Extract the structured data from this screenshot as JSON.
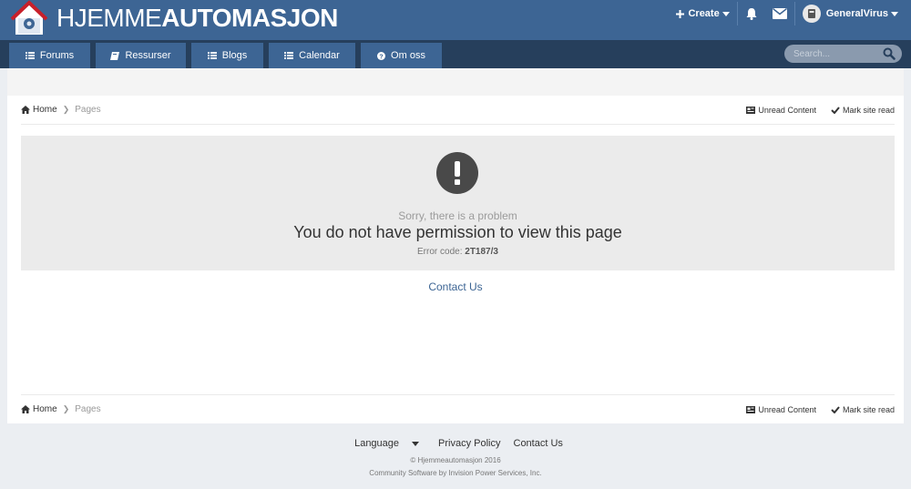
{
  "header": {
    "title_light": "HJEMME",
    "title_bold": "AUTOMASJON",
    "create_label": "Create",
    "username": "GeneralVirus"
  },
  "nav": {
    "tabs": [
      {
        "label": "Forums",
        "icon": "list-icon"
      },
      {
        "label": "Ressurser",
        "icon": "book-icon"
      },
      {
        "label": "Blogs",
        "icon": "list-icon"
      },
      {
        "label": "Calendar",
        "icon": "list-icon"
      },
      {
        "label": "Om oss",
        "icon": "question-icon"
      }
    ],
    "search_placeholder": "Search..."
  },
  "breadcrumb": {
    "home": "Home",
    "current": "Pages",
    "unread": "Unread Content",
    "mark_read": "Mark site read"
  },
  "error": {
    "sorry": "Sorry, there is a problem",
    "title": "You do not have permission to view this page",
    "code_label": "Error code:",
    "code": "2T187/3"
  },
  "contact_label": "Contact Us",
  "footer": {
    "language": "Language",
    "privacy": "Privacy Policy",
    "contact": "Contact Us",
    "copyright": "© Hjemmeautomasjon 2016",
    "powered": "Community Software by Invision Power Services, Inc."
  },
  "colors": {
    "header": "#3d6594",
    "nav_bar": "#263f5c",
    "link": "#3d6594",
    "error_bg": "#ebebeb",
    "page_bg": "#ebeef2"
  }
}
